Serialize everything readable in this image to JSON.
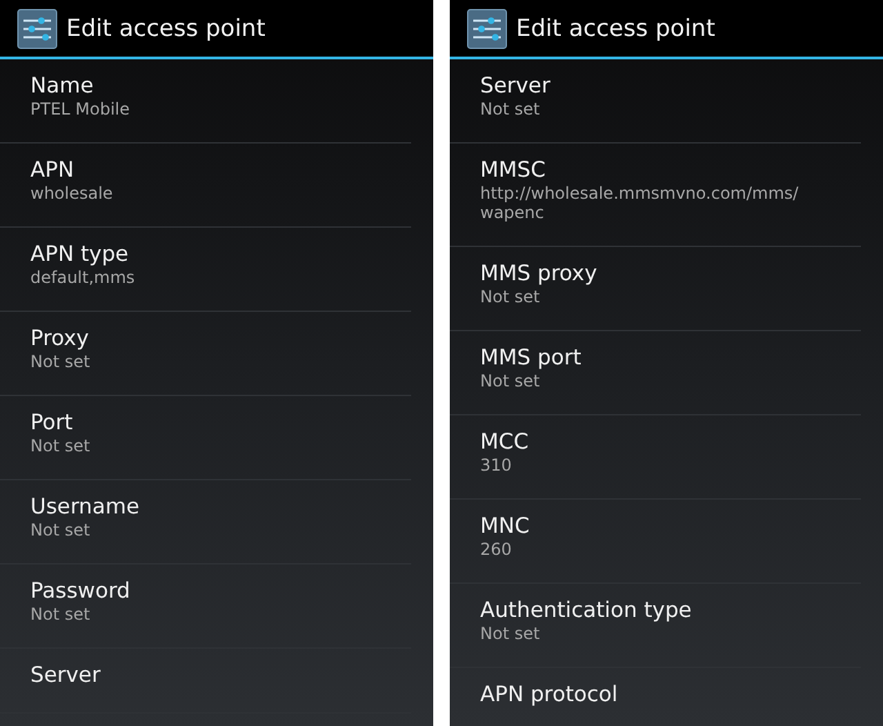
{
  "screens": [
    {
      "action_bar": {
        "title": "Edit access point"
      },
      "items": [
        {
          "title": "Name",
          "summary": "PTEL Mobile"
        },
        {
          "title": "APN",
          "summary": "wholesale"
        },
        {
          "title": "APN type",
          "summary": "default,mms"
        },
        {
          "title": "Proxy",
          "summary": "Not set"
        },
        {
          "title": "Port",
          "summary": "Not set"
        },
        {
          "title": "Username",
          "summary": "Not set"
        },
        {
          "title": "Password",
          "summary": "Not set"
        },
        {
          "title": "Server"
        }
      ]
    },
    {
      "action_bar": {
        "title": "Edit access point"
      },
      "items": [
        {
          "title": "Server",
          "summary": "Not set"
        },
        {
          "title": "MMSC",
          "summary": "http://wholesale.mmsmvno.com/mms/ wapenc"
        },
        {
          "title": "MMS proxy",
          "summary": "Not set"
        },
        {
          "title": "MMS port",
          "summary": "Not set"
        },
        {
          "title": "MCC",
          "summary": "310"
        },
        {
          "title": "MNC",
          "summary": "260"
        },
        {
          "title": "Authentication type",
          "summary": "Not set"
        },
        {
          "title": "APN protocol"
        }
      ]
    }
  ]
}
